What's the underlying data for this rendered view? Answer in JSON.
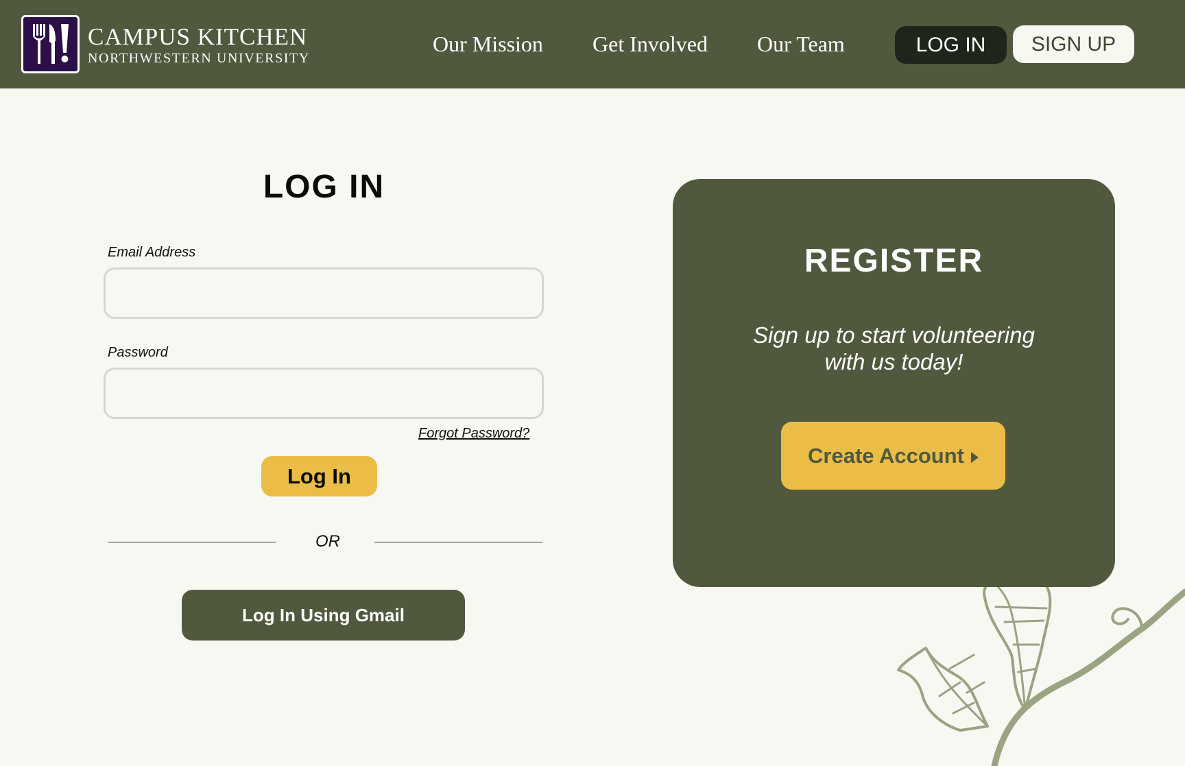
{
  "header": {
    "brand_title": "CAMPUS KITCHEN",
    "brand_subtitle": "NORTHWESTERN UNIVERSITY",
    "logo_icon": "fork-knife-exclamation-icon",
    "nav": [
      {
        "label": "Our Mission"
      },
      {
        "label": "Get Involved"
      },
      {
        "label": "Our Team"
      }
    ],
    "login_label": "LOG IN",
    "signup_label": "SIGN UP"
  },
  "login": {
    "heading": "LOG IN",
    "email_label": "Email Address",
    "email_value": "",
    "password_label": "Password",
    "password_value": "",
    "forgot_label": "Forgot Password?",
    "submit_label": "Log In",
    "or_label": "OR",
    "gmail_label": "Log In Using Gmail"
  },
  "register": {
    "heading": "REGISTER",
    "text_line1": "Sign up to start volunteering",
    "text_line2": "with us today!",
    "button_label": "Create Account",
    "button_icon": "play-arrow-icon"
  },
  "colors": {
    "olive": "#50593d",
    "dark_olive": "#1f251a",
    "gold": "#ebbd47",
    "cream": "#f7f8f2",
    "logo_purple": "#2b0f49",
    "plant": "#9aa382"
  }
}
